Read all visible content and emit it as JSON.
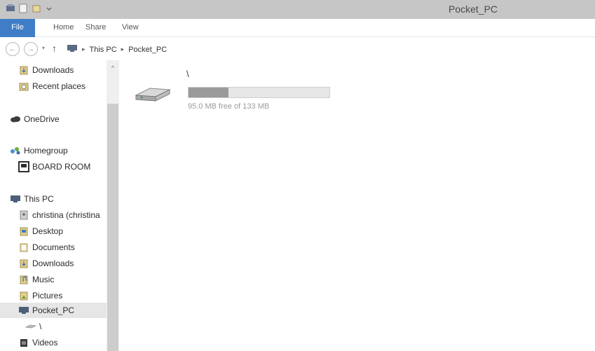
{
  "window": {
    "title": "Pocket_PC"
  },
  "ribbon": {
    "tabs": [
      "File",
      "Home",
      "Share",
      "View"
    ]
  },
  "address": {
    "crumbs": [
      "This PC",
      "Pocket_PC"
    ]
  },
  "nav": {
    "items": [
      {
        "label": "Downloads",
        "icon": "downloads-folder-icon"
      },
      {
        "label": "Recent places",
        "icon": "recent-places-icon"
      },
      {
        "label": "OneDrive",
        "icon": "onedrive-icon"
      },
      {
        "label": "Homegroup",
        "icon": "homegroup-icon"
      },
      {
        "label": "BOARD ROOM",
        "icon": "computer-icon"
      },
      {
        "label": "This PC",
        "icon": "this-pc-icon"
      },
      {
        "label": "christina (christina",
        "icon": "user-folder-icon"
      },
      {
        "label": "Desktop",
        "icon": "desktop-folder-icon"
      },
      {
        "label": "Documents",
        "icon": "documents-folder-icon"
      },
      {
        "label": "Downloads",
        "icon": "downloads-folder-icon"
      },
      {
        "label": "Music",
        "icon": "music-folder-icon"
      },
      {
        "label": "Pictures",
        "icon": "pictures-folder-icon"
      },
      {
        "label": "Pocket_PC",
        "icon": "device-icon"
      },
      {
        "label": "\\",
        "icon": "drive-icon"
      },
      {
        "label": "Videos",
        "icon": "videos-folder-icon"
      }
    ]
  },
  "drive": {
    "name": "\\",
    "free_text": "95.0 MB free of 133 MB",
    "used_fraction": 0.286
  }
}
